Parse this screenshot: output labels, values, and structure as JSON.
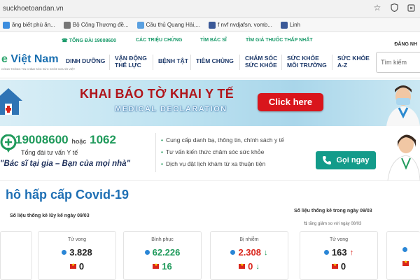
{
  "browser": {
    "url": "suckhoetoandan.vn",
    "bookmarks": [
      {
        "label": "ăng biết phù ăn...",
        "color": "#3c8dde"
      },
      {
        "label": "Bộ Công Thương đề...",
        "color": "#777777"
      },
      {
        "label": "Cầu thủ Quang Hải,...",
        "color": "#5aa0e0"
      },
      {
        "label": "f nvf nvdjafsn. vomb...",
        "color": "#3b5998"
      },
      {
        "label": "Linh",
        "color": "#3b5998"
      }
    ]
  },
  "toplinks": {
    "hotline": "TỔNG ĐÀI 19008600",
    "symptoms": "CÁC TRIỆU CHỨNG",
    "doctor": "TÌM BÁC SĨ",
    "drug_price": "TÌM GIÁ THUỐC THẤP NHẤT",
    "login": "ĐĂNG NH"
  },
  "header": {
    "logo_text": "Việt Nam",
    "logo_prefix": "e",
    "logo_tagline": "CỔNG THÔNG TIN CHĂM SÓC SỨC KHỎE NGƯỜI VIỆT",
    "nav": [
      "DINH DƯỠNG",
      "VẬN ĐỘNG\nTHỂ LỰC",
      "BỆNH TẬT",
      "TIÊM CHỦNG",
      "CHĂM SÓC\nSỨC KHỎE",
      "SỨC KHỎE\nMÔI TRƯỜNG",
      "SỨC KHỎE\nA-Z"
    ],
    "search_placeholder": "Tìm kiếm"
  },
  "banner": {
    "title": "KHAI BÁO TỜ KHAI Y TẾ",
    "subtitle": "MEDICAL DECLARATION",
    "button": "Click here"
  },
  "hotline": {
    "number": "19008600",
    "or": "hoặc",
    "alt_number": "1062",
    "label": "Tổng đài tư vấn Y tế",
    "quote": "\"Bác sĩ tại gia – Bạn của mọi nhà\"",
    "services": [
      "Cung cấp danh bạ, thông tin, chính sách y tế",
      "Tư vấn kiến thức chăm sóc sức khỏe",
      "Dịch vụ đặt lịch khám từ xa thuận tiện"
    ],
    "call_button": "Gọi ngay"
  },
  "covid": {
    "title": "hô hấp cấp Covid-19",
    "cumulative_label": "Số liệu thống kê lũy kế ngày 09/03",
    "daily_label": "Số liệu thống kê trong ngày 09/03",
    "daily_note": "tăng giảm so với ngày 08/03",
    "cards": [
      {
        "label": "Tử vong",
        "world": "3.828",
        "vn": "0",
        "world_color": "#222222",
        "vn_color": "#222222"
      },
      {
        "label": "Bình phục",
        "world": "62.226",
        "vn": "16",
        "world_color": "#1f9a5b",
        "vn_color": "#1f9a5b"
      },
      {
        "label": "Bị nhiễm",
        "world": "2.308",
        "vn": "0",
        "world_color": "#d9261c",
        "vn_color": "#d9261c",
        "world_arrow": "↓",
        "vn_arrow": "↓"
      },
      {
        "label": "Tử vong",
        "world": "163",
        "vn": "0",
        "world_color": "#222222",
        "vn_color": "#222222",
        "world_arrow": "↑"
      }
    ]
  }
}
